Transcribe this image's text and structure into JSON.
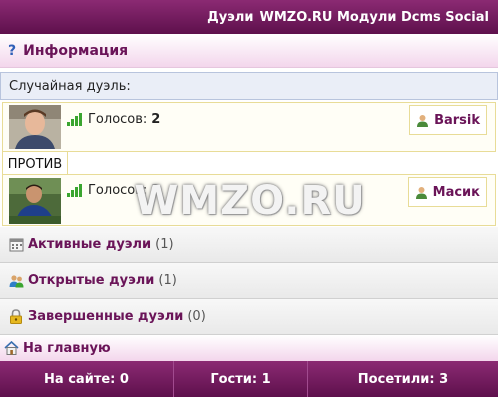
{
  "header": {
    "title": "Дуэли",
    "site": "WMZO.RU Модули Dcms Social"
  },
  "info": {
    "label": "Информация",
    "icon": "question-icon"
  },
  "random_duel": {
    "title": "Случайная дуэль:",
    "versus_label": "ПРОТИВ",
    "participants": [
      {
        "name": "Barsik",
        "votes_label": "Голосов:",
        "votes": "2"
      },
      {
        "name": "Масик",
        "votes_label": "Голосов:",
        "votes": "2"
      }
    ]
  },
  "watermark": "WMZO.RU",
  "menu": [
    {
      "label": "Активные дуэли",
      "count": "(1)",
      "icon": "calendar-icon"
    },
    {
      "label": "Открытые дуэли",
      "count": "(1)",
      "icon": "users-icon"
    },
    {
      "label": "Завершенные дуэли",
      "count": "(0)",
      "icon": "lock-icon"
    }
  ],
  "home": {
    "label": "На главную",
    "icon": "home-icon"
  },
  "footer": {
    "online": "На сайте: 0",
    "guests": "Гости: 1",
    "visitors": "Посетили: 3"
  },
  "colors": {
    "brand": "#6a1458",
    "header_bg": "#7a1f66",
    "signal": "#3aa530"
  }
}
